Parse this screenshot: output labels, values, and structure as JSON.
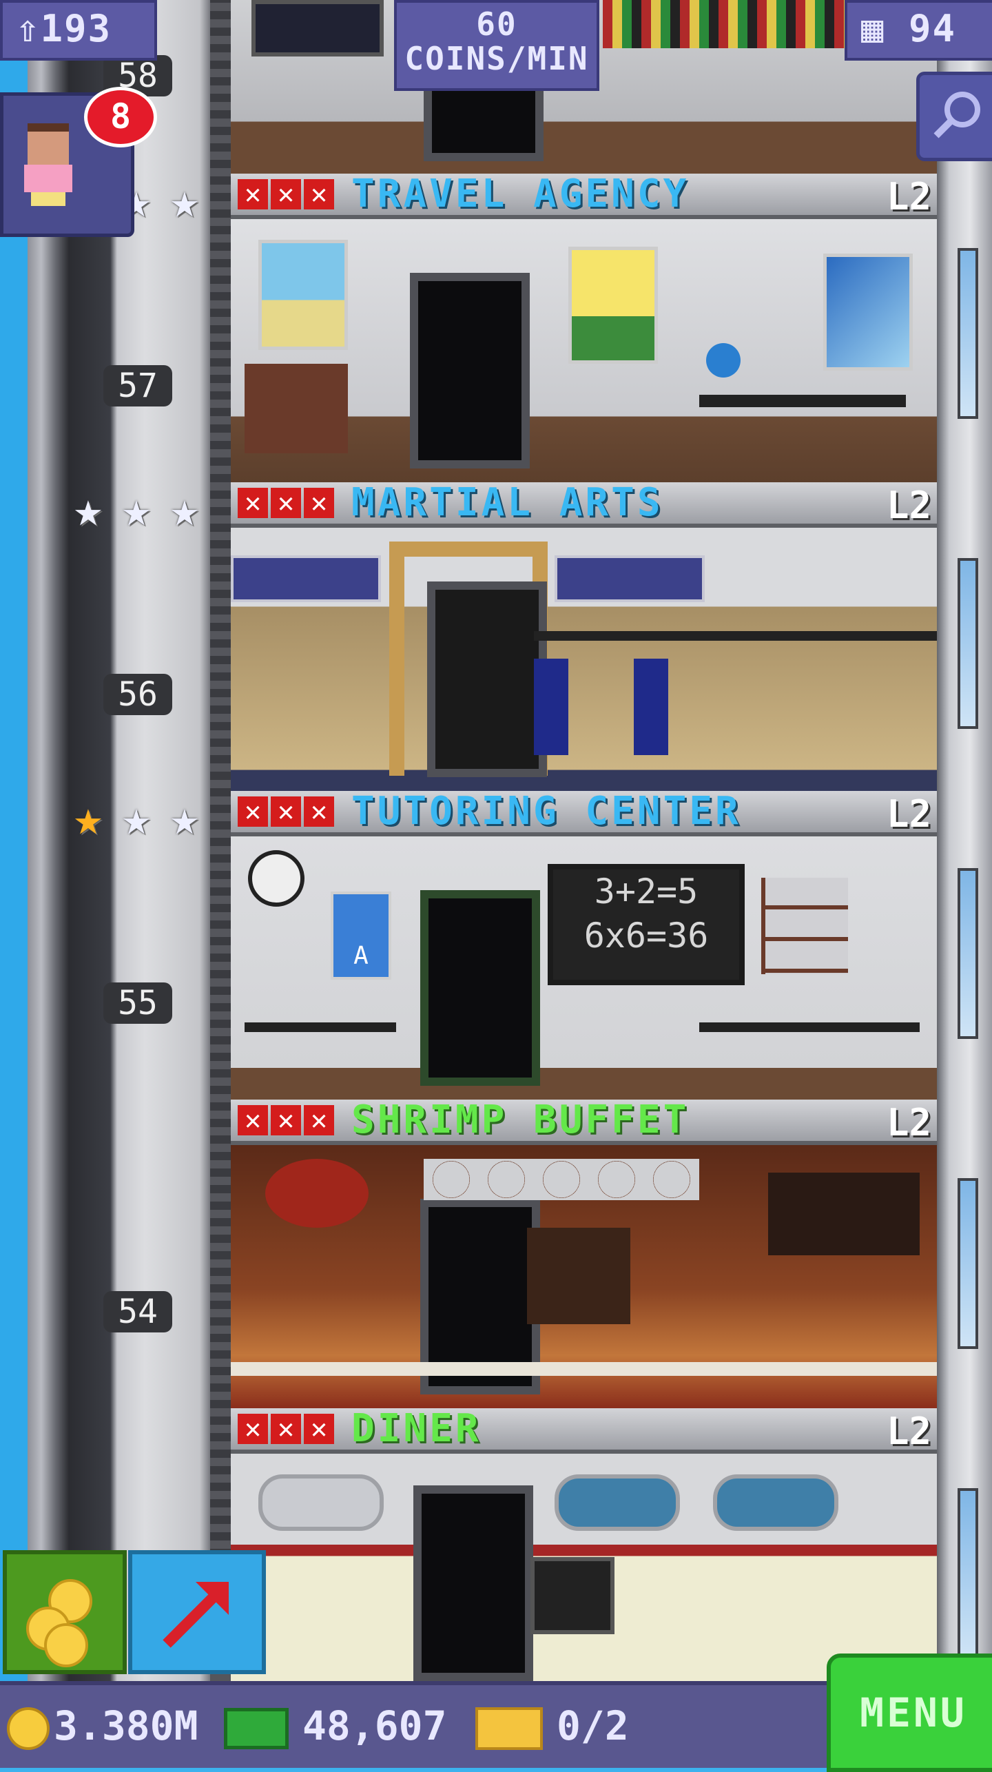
{
  "hud": {
    "population": "193",
    "coins_rate_value": "60",
    "coins_rate_unit": "COINS/MIN",
    "floor_count": "94",
    "notification_count": "8"
  },
  "floors": [
    {
      "number": "58",
      "name": "TRAVEL AGENCY",
      "level": "L2",
      "name_color": "blue",
      "stars": [
        "silver",
        "silver",
        "silver"
      ]
    },
    {
      "number": "57",
      "name": "MARTIAL ARTS",
      "level": "L2",
      "name_color": "blue",
      "stars": [
        "silver",
        "silver",
        "silver"
      ]
    },
    {
      "number": "56",
      "name": "TUTORING CENTER",
      "level": "L2",
      "name_color": "blue",
      "stars": [
        "gold",
        "silver",
        "silver"
      ]
    },
    {
      "number": "55",
      "name": "SHRIMP BUFFET",
      "level": "L2",
      "name_color": "green"
    },
    {
      "number": "54",
      "name": "DINER",
      "level": "L2",
      "name_color": "green"
    }
  ],
  "room_text": {
    "chalkboard_line1": "3+2=5",
    "chalkboard_line2": "6x6=36",
    "poster_letter": "A"
  },
  "footer": {
    "coins": "3.380M",
    "bux": "48,607",
    "tickets": "0/2",
    "menu_label": "MENU"
  },
  "colors": {
    "blue_name": "#39b8f3",
    "green_name": "#64e84a",
    "hud_bg": "#5c5aa4",
    "menu_green": "#3ad13b"
  },
  "icons": [
    "population-icon",
    "building-icon",
    "search-icon",
    "coins-icon",
    "elevator-arrow-icon",
    "coin-icon",
    "bux-icon",
    "ticket-icon",
    "x-mark-icon",
    "star-icon"
  ]
}
